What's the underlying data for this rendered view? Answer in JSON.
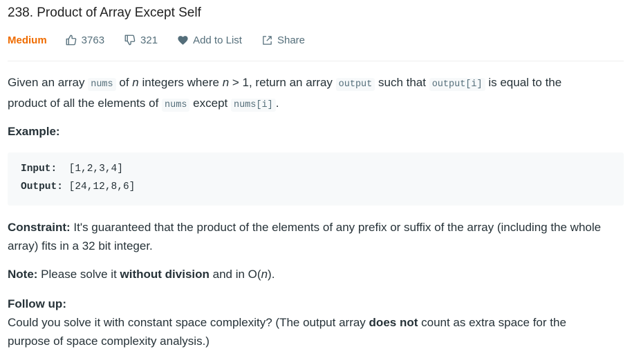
{
  "problem": {
    "title": "238. Product of Array Except Self",
    "difficulty": "Medium",
    "likes": "3763",
    "dislikes": "321",
    "add_to_list": "Add to List",
    "share": "Share"
  },
  "description": {
    "p1": {
      "t1": "Given an array ",
      "c1": "nums",
      "t2": " of ",
      "n1": "n",
      "t3": " integers where ",
      "n2": "n",
      "t4": " > 1,  return an array ",
      "c2": "output",
      "t5": " such that ",
      "c3": "output[i]",
      "t6": " is equal to the",
      "t7": "product of all the elements of ",
      "c4": "nums",
      "t8": " except ",
      "c5": "nums[i]",
      "t9": "."
    },
    "example_heading": "Example:",
    "example": {
      "input_label": "Input:",
      "input_value": "[1,2,3,4]",
      "output_label": "Output:",
      "output_value": "[24,12,8,6]"
    },
    "constraint": {
      "label": "Constraint:",
      "line1": " It's guaranteed that the product of the elements of any prefix or suffix of the array (including the whole",
      "line2": "array) fits in a 32 bit integer."
    },
    "note": {
      "label": "Note:",
      "t1": " Please solve it ",
      "bold": "without division",
      "t2": " and in O(",
      "n": "n",
      "t3": ")."
    },
    "follow_up": {
      "heading": "Follow up:",
      "t1": "Could you solve it with constant space complexity? (The output array ",
      "bold": "does not",
      "t2": " count as extra space for the",
      "line2": "purpose of space complexity analysis.)"
    }
  },
  "colors": {
    "difficulty_medium": "#ef6c00",
    "meta_text": "#546e7a",
    "code_bg": "#f7f9fa"
  },
  "icons": {
    "likes": "thumbs-up-icon",
    "dislikes": "thumbs-down-icon",
    "add_to_list": "heart-icon",
    "share": "share-icon"
  }
}
